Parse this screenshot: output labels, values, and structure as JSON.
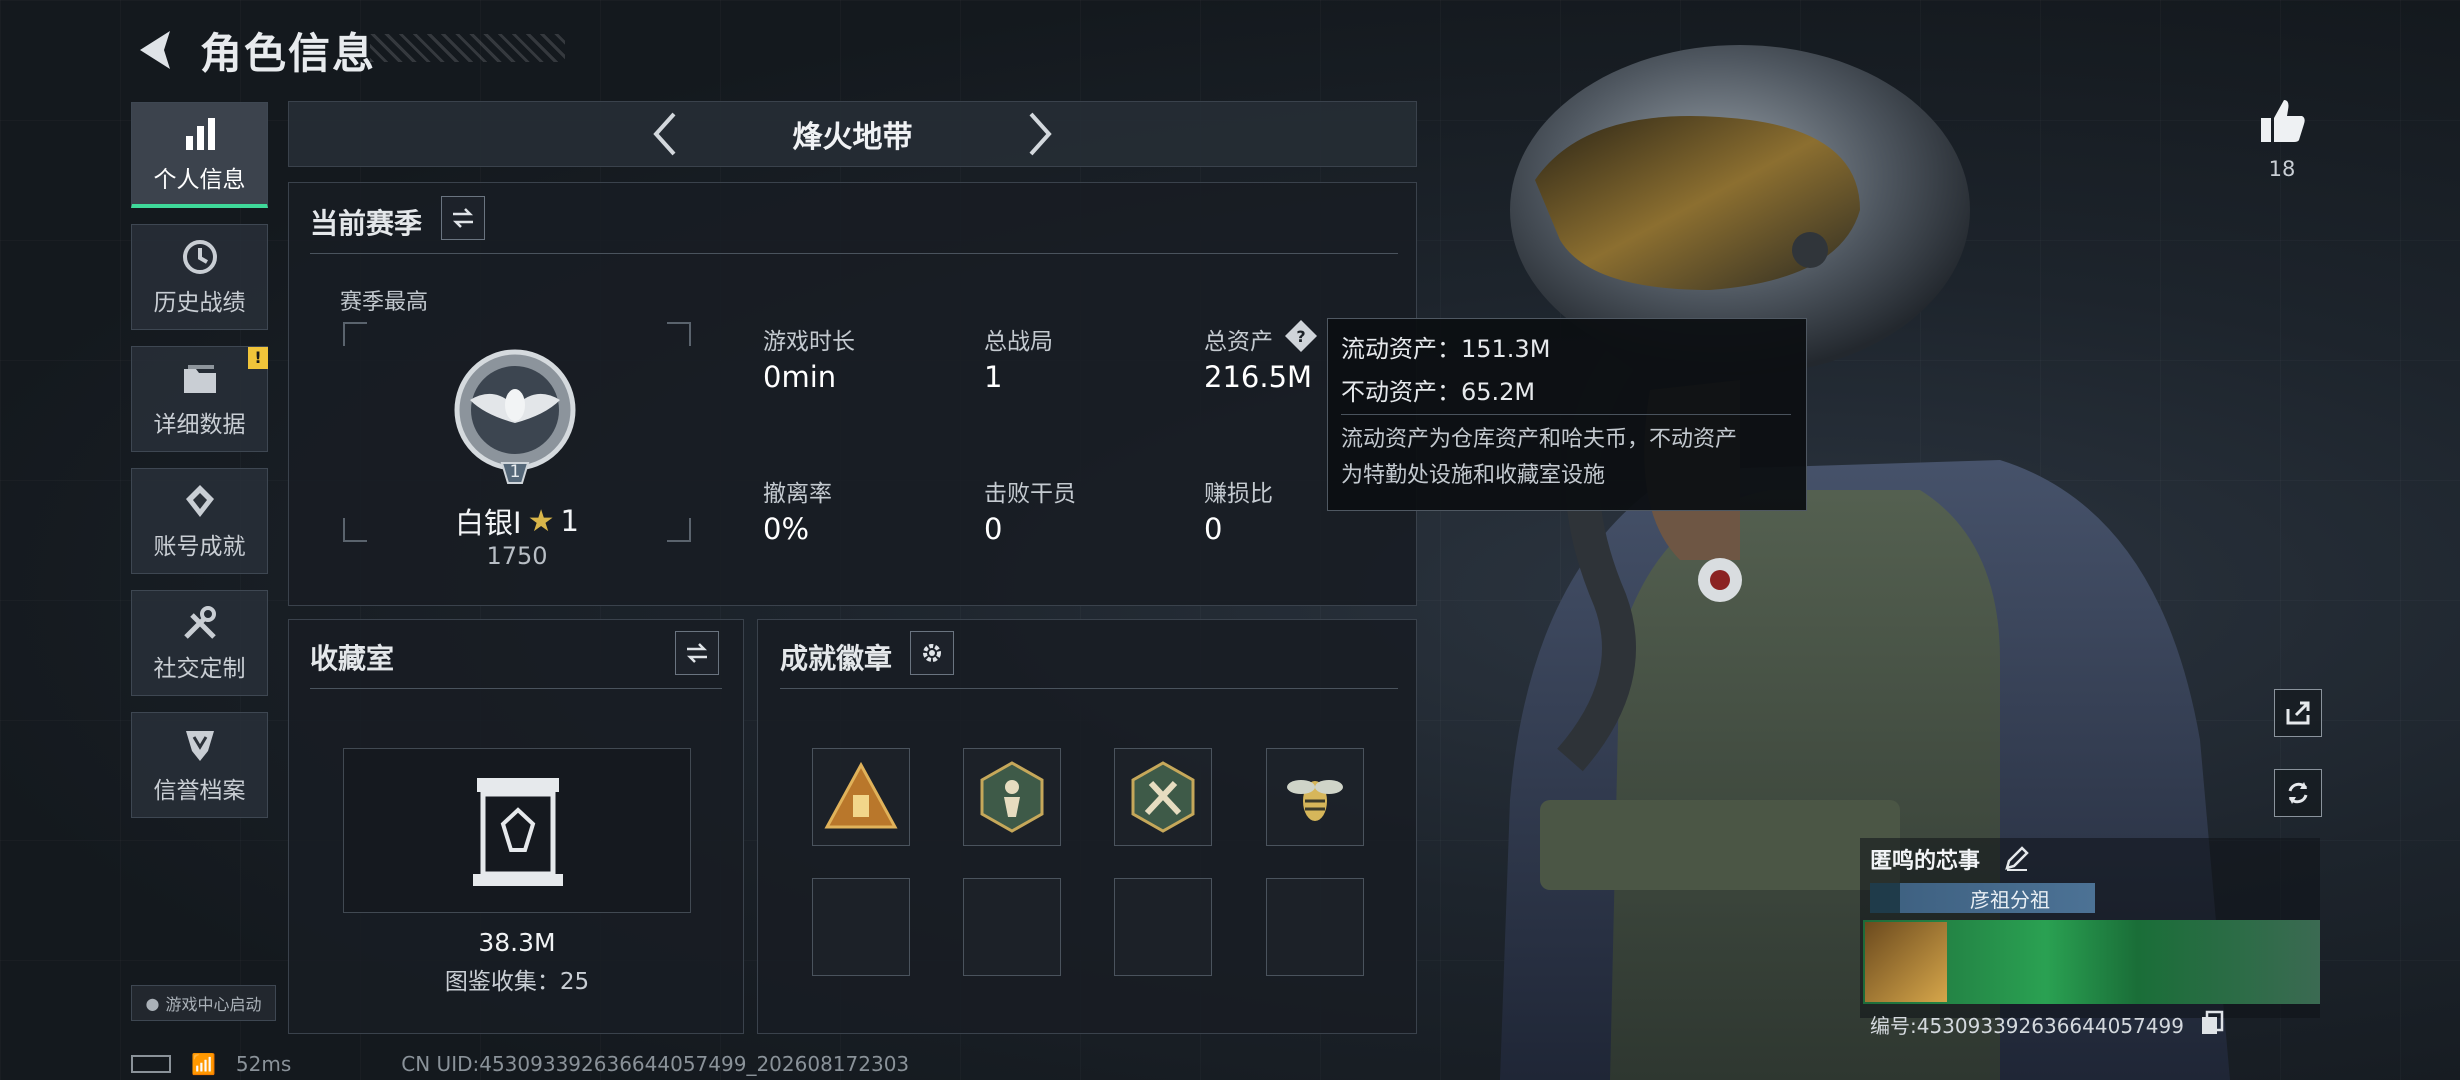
{
  "header": {
    "title": "角色信息"
  },
  "sidebar": {
    "items": [
      {
        "label": "个人信息",
        "active": true,
        "icon": "bar-chart-icon"
      },
      {
        "label": "历史战绩",
        "icon": "history-icon"
      },
      {
        "label": "详细数据",
        "icon": "folder-icon",
        "alert": "!"
      },
      {
        "label": "账号成就",
        "icon": "achievement-icon"
      },
      {
        "label": "社交定制",
        "icon": "tools-icon"
      },
      {
        "label": "信誉档案",
        "icon": "shield-icon"
      }
    ],
    "launch_label": "游戏中心启动"
  },
  "mode": {
    "title": "烽火地带"
  },
  "season": {
    "title": "当前赛季",
    "best_label": "赛季最高",
    "rank_name": "白银I",
    "rank_star": "1",
    "rank_points": "1750",
    "emblem_level": "1",
    "stats": [
      {
        "label": "游戏时长",
        "value": "0min"
      },
      {
        "label": "总战局",
        "value": "1"
      },
      {
        "label": "总资产",
        "value": "216.5M"
      },
      {
        "label": "撤离率",
        "value": "0%"
      },
      {
        "label": "击败干员",
        "value": "0"
      },
      {
        "label": "赚损比",
        "value": "0"
      }
    ]
  },
  "tooltip": {
    "line1": "流动资产：151.3M",
    "line2": "不动资产：65.2M",
    "note1": "流动资产为仓库资产和哈夫币，不动资产",
    "note2": "为特勤处设施和收藏室设施"
  },
  "collection": {
    "title": "收藏室",
    "value": "38.3M",
    "count_text": "图鉴收集：25"
  },
  "achievements": {
    "title": "成就徽章",
    "badges": [
      "triangle-badge-icon",
      "hex-runner-badge-icon",
      "hex-tools-badge-icon",
      "wasp-badge-icon"
    ]
  },
  "profile": {
    "likes": "18",
    "name": "匿鸣的芯事",
    "club": "彦祖分祖",
    "uid_text": "编号:453093392636644057499"
  },
  "status": {
    "ping": "52ms",
    "uid": "CN UID:453093392636644057499_202608172303"
  },
  "colors": {
    "accent": "#3fd99a",
    "alert": "#f0c43a",
    "club": "#4c7295"
  }
}
